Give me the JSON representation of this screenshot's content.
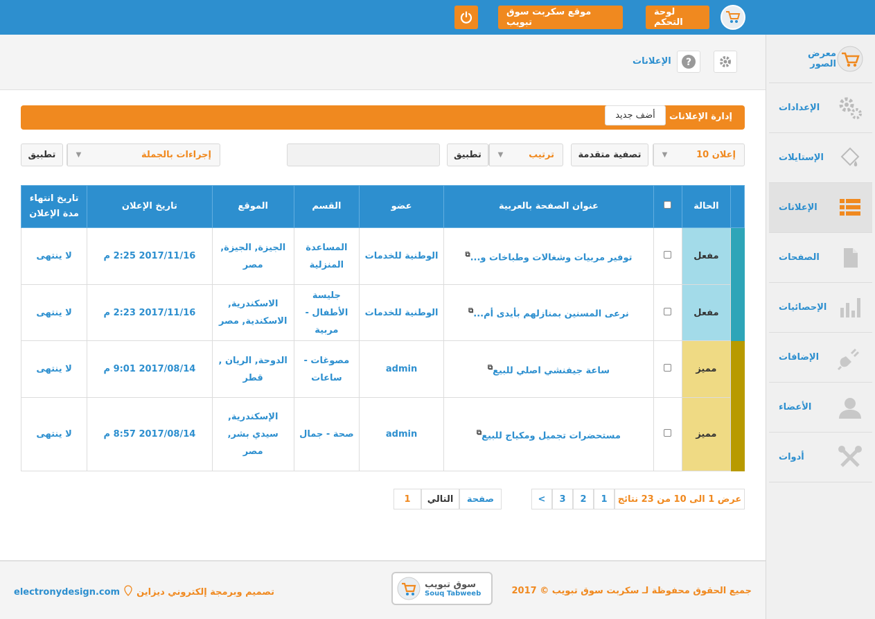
{
  "topbar": {
    "dashboard": "لوحة التحكم",
    "site": "موقع سكربت سوق تبويب",
    "power_icon": "power-icon",
    "logo_icon": "cart-icon"
  },
  "sidebar": {
    "items": [
      {
        "label": "معرض الصور",
        "icon": "cart-icon"
      },
      {
        "label": "الإعدادات",
        "icon": "gears-icon"
      },
      {
        "label": "الإستايلات",
        "icon": "paint-bucket-icon"
      },
      {
        "label": "الإعلانات",
        "icon": "list-icon"
      },
      {
        "label": "الصفحات",
        "icon": "page-icon"
      },
      {
        "label": "الإحصائيات",
        "icon": "bar-chart-icon"
      },
      {
        "label": "الإضافات",
        "icon": "plug-icon"
      },
      {
        "label": "الأعضاء",
        "icon": "user-icon"
      },
      {
        "label": "أدوات",
        "icon": "tools-icon"
      }
    ]
  },
  "pageheader": {
    "title": "الإعلانات",
    "help_icon": "help-icon",
    "settings_icon": "gear-icon"
  },
  "manage": {
    "title": "إدارة الإعلانات",
    "add_new": "أضف جديد"
  },
  "filters": {
    "per_page": "10 إعلان",
    "advanced": "تصفية متقدمة",
    "sort": "ترتيب",
    "apply1": "تطبيق",
    "search_value": "",
    "bulk": "إجراءات بالجملة",
    "apply2": "تطبيق"
  },
  "table": {
    "headers": {
      "status": "الحالة",
      "title": "عنوان الصفحة بالعربية",
      "member": "عضو",
      "category": "القسم",
      "location": "الموقع",
      "date": "تاريخ الإعلان",
      "expiry": "تاريخ انتهاء مدة الإعلان"
    },
    "rows": [
      {
        "status": "مفعل",
        "title": "توفير مربيات وشغالات وطباخات و...",
        "member": "الوطنية للخدمات",
        "category": "المساعدة المنزلية",
        "location": "الجيزة, الجيزة, مصر",
        "date": "2017/11/16 2:25 م",
        "expiry": "لا ينتهى",
        "kind": "active"
      },
      {
        "status": "مفعل",
        "title": "نرعى المسنين بمنازلهم بأيدى أم...",
        "member": "الوطنية للخدمات",
        "category": "جليسة الأطفال - مربية",
        "location": "الاسكندرية, الاسكندية, مصر",
        "date": "2017/11/16 2:23 م",
        "expiry": "لا ينتهى",
        "kind": "active"
      },
      {
        "status": "مميز",
        "title": "ساعة جيفنشي اصلي للبيع",
        "member": "admin",
        "category": "مصوغات - ساعات",
        "location": "الدوحة, الريان , قطر",
        "date": "2017/08/14 9:01 م",
        "expiry": "لا ينتهى",
        "kind": "featured"
      },
      {
        "status": "مميز",
        "title": "مستحضرات تجميل ومكياج للبيع",
        "member": "admin",
        "category": "صحة - جمال",
        "location": "الإسكندرية, سيدي بشر, مصر",
        "date": "2017/08/14 8:57 م",
        "expiry": "لا ينتهى",
        "kind": "featured"
      }
    ]
  },
  "pagination": {
    "info": "عرض 1 الى 10 من 23 نتائج",
    "pages": [
      "1",
      "2",
      "3"
    ],
    "prev": "<",
    "page_label": "صفحة",
    "next": "التالي",
    "current": "1"
  },
  "footer": {
    "rights": "جميع الحقوق محفوظة لـ سكربت سوق تبويب © 2017",
    "logo_ar": "سوق تبويب",
    "logo_en": "Souq Tabweeb",
    "design": "تصميم وبرمجة إلكتروني ديزاين",
    "domain": "electronydesign.com"
  },
  "colors": {
    "primary": "#2d8fcf",
    "accent": "#f0891f",
    "active_cell": "#a3dbe9",
    "active_stripe": "#2ea5b8",
    "featured_cell": "#efda84",
    "featured_stripe": "#b89a00"
  }
}
